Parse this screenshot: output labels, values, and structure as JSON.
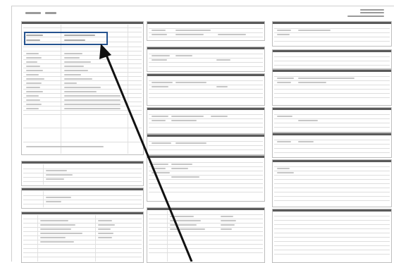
{
  "document": {
    "kind": "scanned-form-sheet",
    "columns": 3,
    "has_highlight_box": true,
    "highlight_color": "#25538f",
    "arrow_color": "#111111",
    "text_is_legible": false
  }
}
